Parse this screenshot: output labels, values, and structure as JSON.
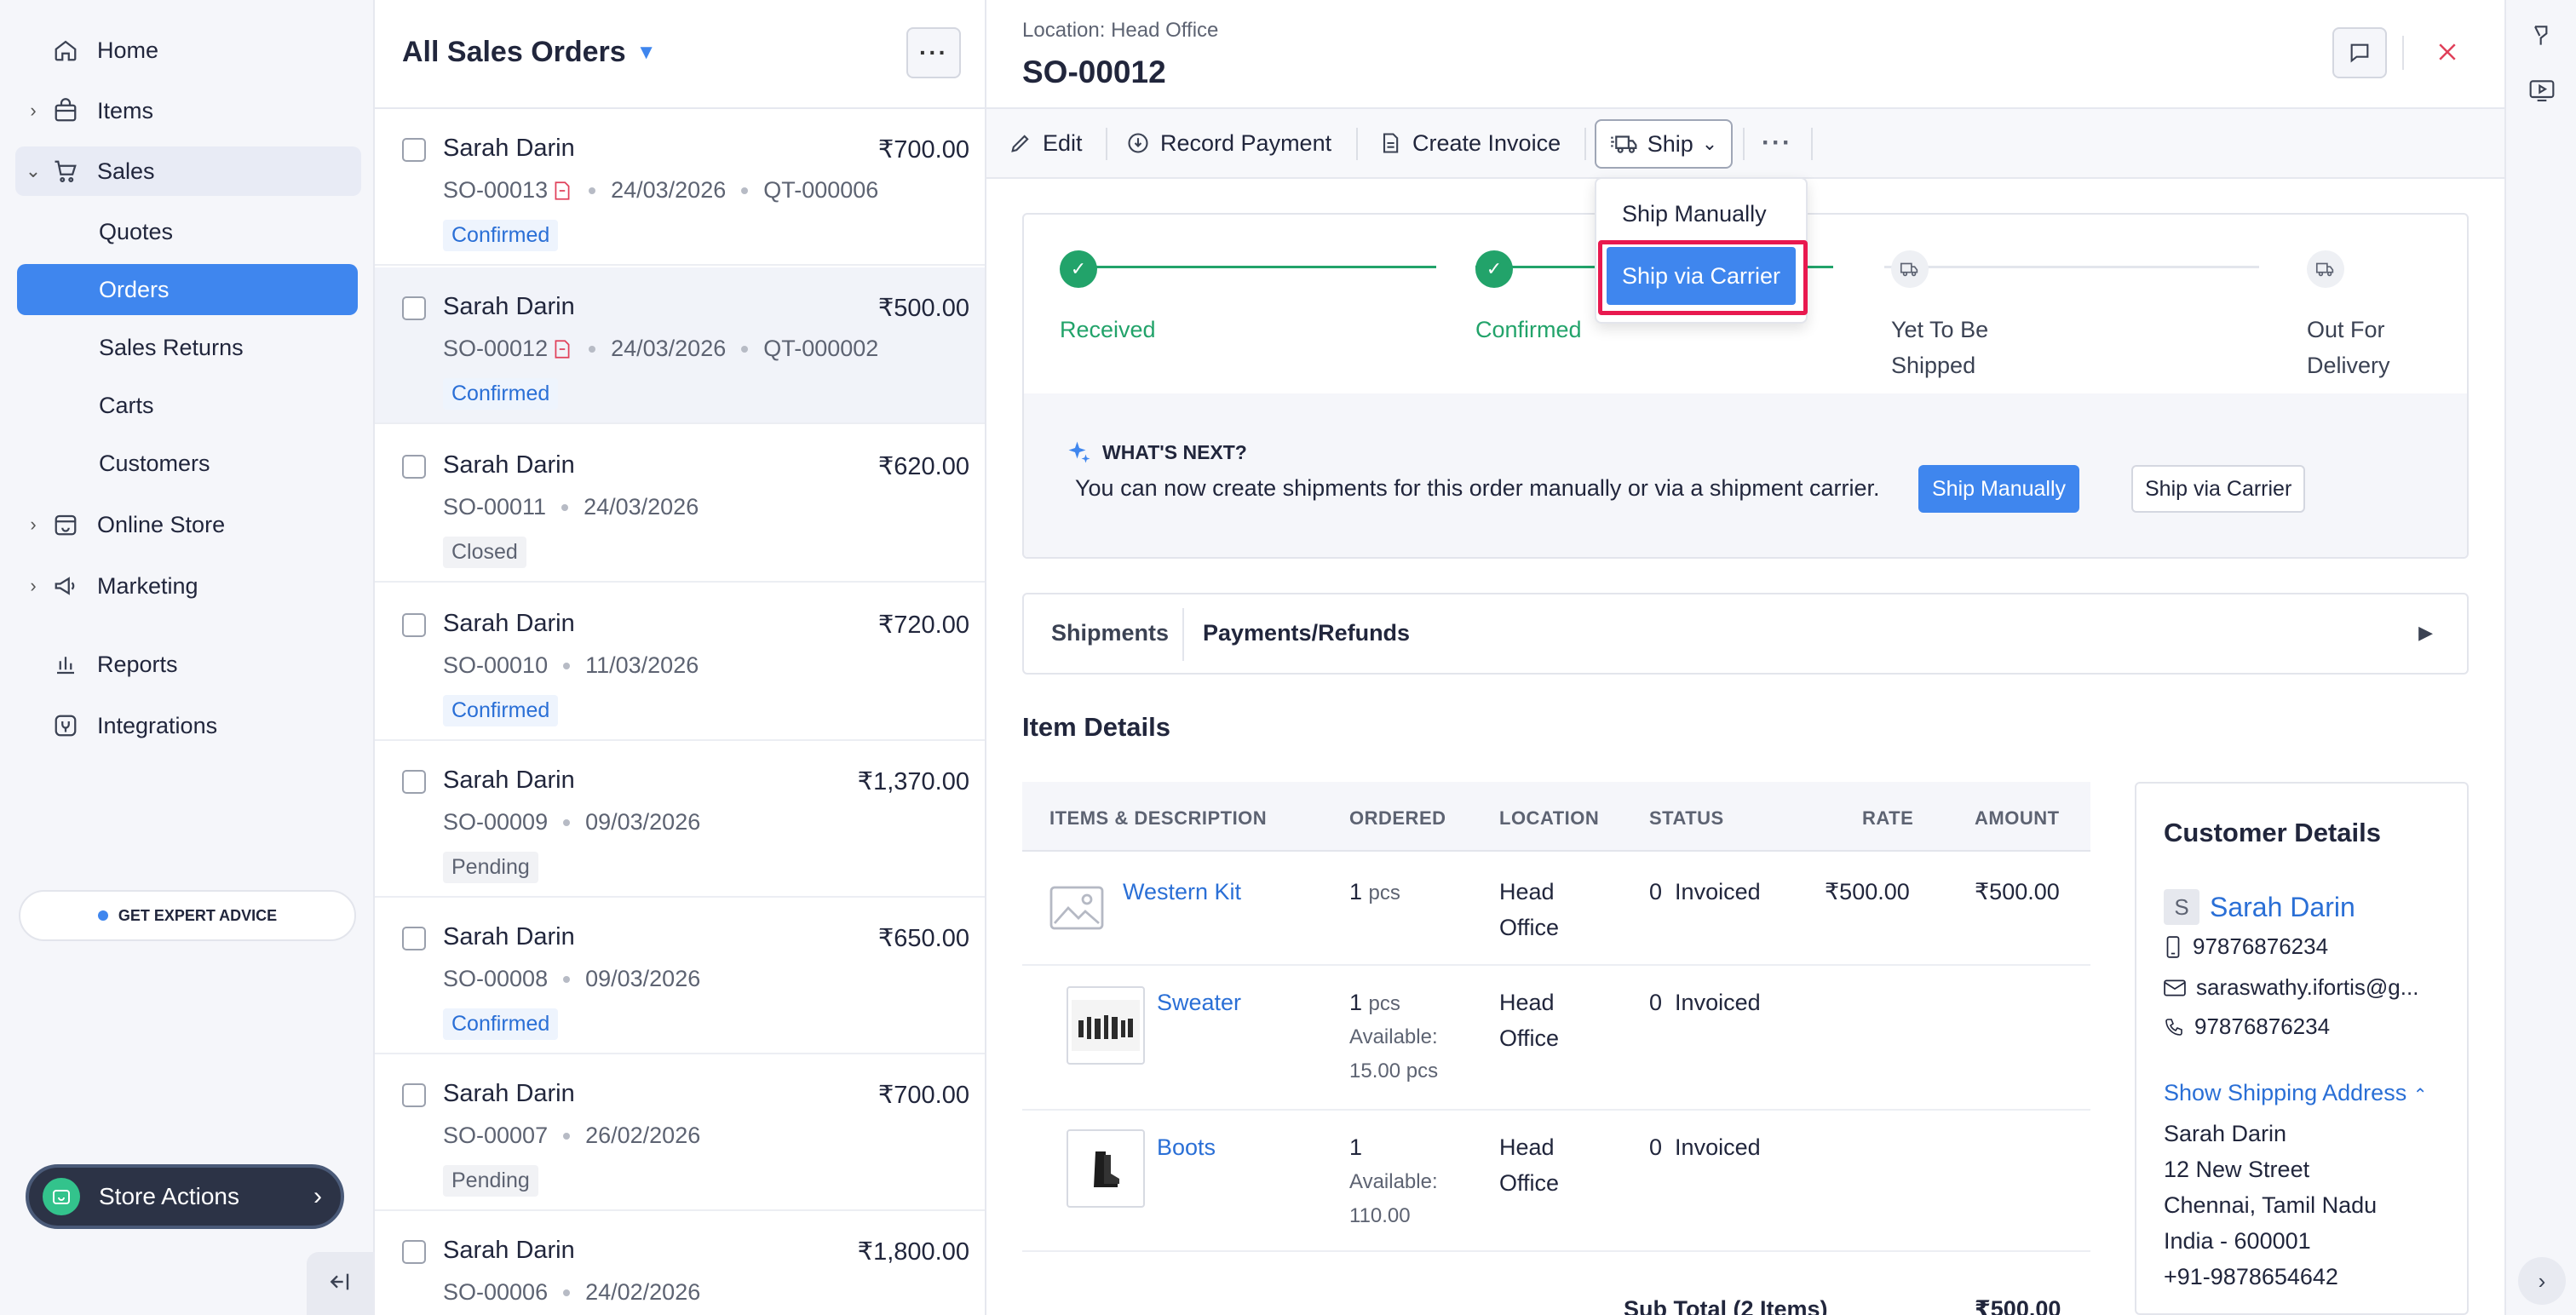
{
  "nav": {
    "home": "Home",
    "items": "Items",
    "sales": "Sales",
    "sales_sub": [
      "Quotes",
      "Orders",
      "Sales Returns",
      "Carts",
      "Customers"
    ],
    "online_store": "Online Store",
    "marketing": "Marketing",
    "reports": "Reports",
    "integrations": "Integrations",
    "expert_advice": "GET EXPERT ADVICE",
    "store_actions": "Store Actions"
  },
  "list": {
    "title": "All Sales Orders",
    "orders": [
      {
        "customer": "Sarah Darin",
        "amount": "₹700.00",
        "number": "SO-00013",
        "date": "24/03/2026",
        "quote": "QT-000006",
        "status": "Confirmed"
      },
      {
        "customer": "Sarah Darin",
        "amount": "₹500.00",
        "number": "SO-00012",
        "date": "24/03/2026",
        "quote": "QT-000002",
        "status": "Confirmed"
      },
      {
        "customer": "Sarah Darin",
        "amount": "₹620.00",
        "number": "SO-00011",
        "date": "24/03/2026",
        "quote": "",
        "status": "Closed"
      },
      {
        "customer": "Sarah Darin",
        "amount": "₹720.00",
        "number": "SO-00010",
        "date": "11/03/2026",
        "quote": "",
        "status": "Confirmed"
      },
      {
        "customer": "Sarah Darin",
        "amount": "₹1,370.00",
        "number": "SO-00009",
        "date": "09/03/2026",
        "quote": "",
        "status": "Pending"
      },
      {
        "customer": "Sarah Darin",
        "amount": "₹650.00",
        "number": "SO-00008",
        "date": "09/03/2026",
        "quote": "",
        "status": "Confirmed"
      },
      {
        "customer": "Sarah Darin",
        "amount": "₹700.00",
        "number": "SO-00007",
        "date": "26/02/2026",
        "quote": "",
        "status": "Pending"
      },
      {
        "customer": "Sarah Darin",
        "amount": "₹1,800.00",
        "number": "SO-00006",
        "date": "24/02/2026",
        "quote": "",
        "status": ""
      }
    ]
  },
  "detail": {
    "location": "Location: Head Office",
    "title": "SO-00012",
    "toolbar": {
      "edit": "Edit",
      "record_payment": "Record Payment",
      "create_invoice": "Create Invoice",
      "ship": "Ship"
    },
    "ship_menu": {
      "manual": "Ship Manually",
      "carrier": "Ship via Carrier"
    },
    "steps": [
      {
        "label_line1": "Received",
        "label_line2": "",
        "state": "done"
      },
      {
        "label_line1": "Confirmed",
        "label_line2": "",
        "state": "done"
      },
      {
        "label_line1": "Yet To Be",
        "label_line2": "Shipped",
        "state": "todo"
      },
      {
        "label_line1": "Out For",
        "label_line2": "Delivery",
        "state": "todo"
      }
    ],
    "whats_next": {
      "title": "WHAT'S NEXT?",
      "text": "You can now create shipments for this order manually or via a shipment carrier.",
      "btn_manual": "Ship Manually",
      "btn_carrier": "Ship via Carrier"
    },
    "tabs": [
      "Shipments",
      "Payments/Refunds"
    ],
    "item_details_title": "Item Details",
    "table": {
      "headers": [
        "ITEMS & DESCRIPTION",
        "ORDERED",
        "LOCATION",
        "STATUS",
        "RATE",
        "AMOUNT"
      ],
      "rows": [
        {
          "name": "Western Kit",
          "qty": "1",
          "unit": "pcs",
          "available": "",
          "location_1": "Head",
          "location_2": "Office",
          "status_qty": "0",
          "status": "Invoiced",
          "rate": "₹500.00",
          "amount": "₹500.00"
        },
        {
          "name": "Sweater",
          "qty": "1",
          "unit": "pcs",
          "available": "Available:",
          "available_val": "15.00 pcs",
          "location_1": "Head",
          "location_2": "Office",
          "status_qty": "0",
          "status": "Invoiced",
          "rate": "",
          "amount": ""
        },
        {
          "name": "Boots",
          "qty": "1",
          "unit": "",
          "available": "Available:",
          "available_val": "110.00",
          "location_1": "Head",
          "location_2": "Office",
          "status_qty": "0",
          "status": "Invoiced",
          "rate": "",
          "amount": ""
        }
      ],
      "subtotal_label": "Sub Total (2 Items)",
      "subtotal_value": "₹500.00"
    },
    "customer": {
      "title": "Customer Details",
      "initial": "S",
      "name": "Sarah Darin",
      "mobile": "97876876234",
      "email": "saraswathy.ifortis@g...",
      "phone": "97876876234",
      "show_shipping": "Show Shipping Address",
      "address": [
        "Sarah Darin",
        "12 New Street",
        "Chennai, Tamil Nadu",
        "India - 600001",
        "+91-9878654642"
      ]
    }
  },
  "colors": {
    "accent": "#3f86ee",
    "success": "#22a36a",
    "highlight": "#e8194f",
    "close": "#e0405a"
  }
}
